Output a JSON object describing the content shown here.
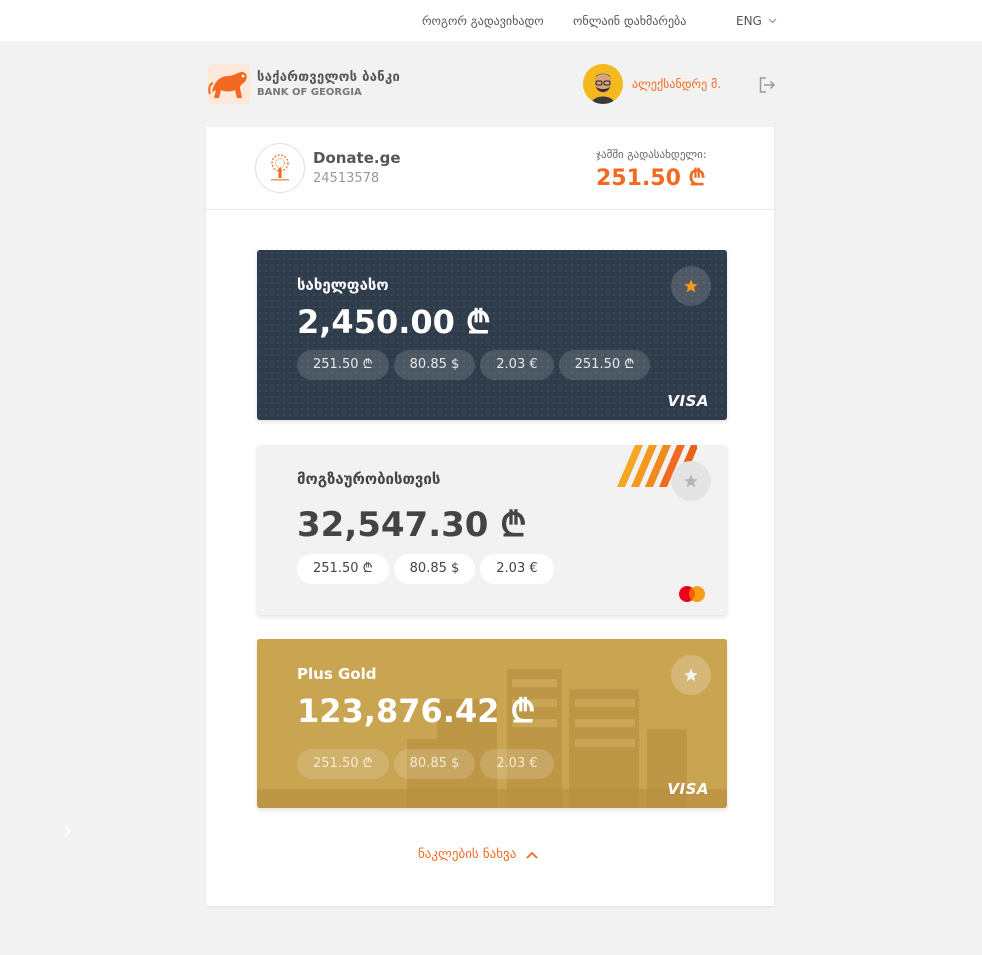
{
  "topnav": {
    "how_to_pay": "როგორ გადავიხადო",
    "online_help": "ონლაინ დახმარება",
    "language": "ENG"
  },
  "brand": {
    "name_geo": "საქართველოს ბანკი",
    "name_en": "BANK OF GEORGIA",
    "color": "#f26a21"
  },
  "user": {
    "name": "ალექსანდრე მ."
  },
  "merchant": {
    "name": "Donate.ge",
    "id": "24513578",
    "total_label": "ჯამში გადასახდელი:",
    "total_amount": "251.50 ₾"
  },
  "cards": [
    {
      "name": "სახელფასო",
      "balance": "2,450.00 ₾",
      "conversions": [
        "251.50 ₾",
        "80.85 $",
        "2.03 €",
        "251.50 ₾"
      ],
      "favorite": true,
      "network": "VISA",
      "color": "#2f3c4b"
    },
    {
      "name": "მოგზაურობისთვის",
      "balance": "32,547.30 ₾",
      "conversions": [
        "251.50 ₾",
        "80.85 $",
        "2.03 €"
      ],
      "favorite": false,
      "network": "mastercard",
      "color": "#f2f2f2"
    },
    {
      "name": "Plus Gold",
      "balance": "123,876.42 ₾",
      "conversions": [
        "251.50 ₾",
        "80.85 $",
        "2.03 €"
      ],
      "favorite": false,
      "network": "VISA",
      "color": "#c9a451"
    }
  ],
  "show_less_label": "ნაკლების ნახვა",
  "icons": {
    "star": "star-icon",
    "logout": "logout-icon",
    "chevron_down": "chevron-down-icon",
    "chevron_up": "chevron-up-icon",
    "chevron_right": "chevron-right-icon"
  }
}
